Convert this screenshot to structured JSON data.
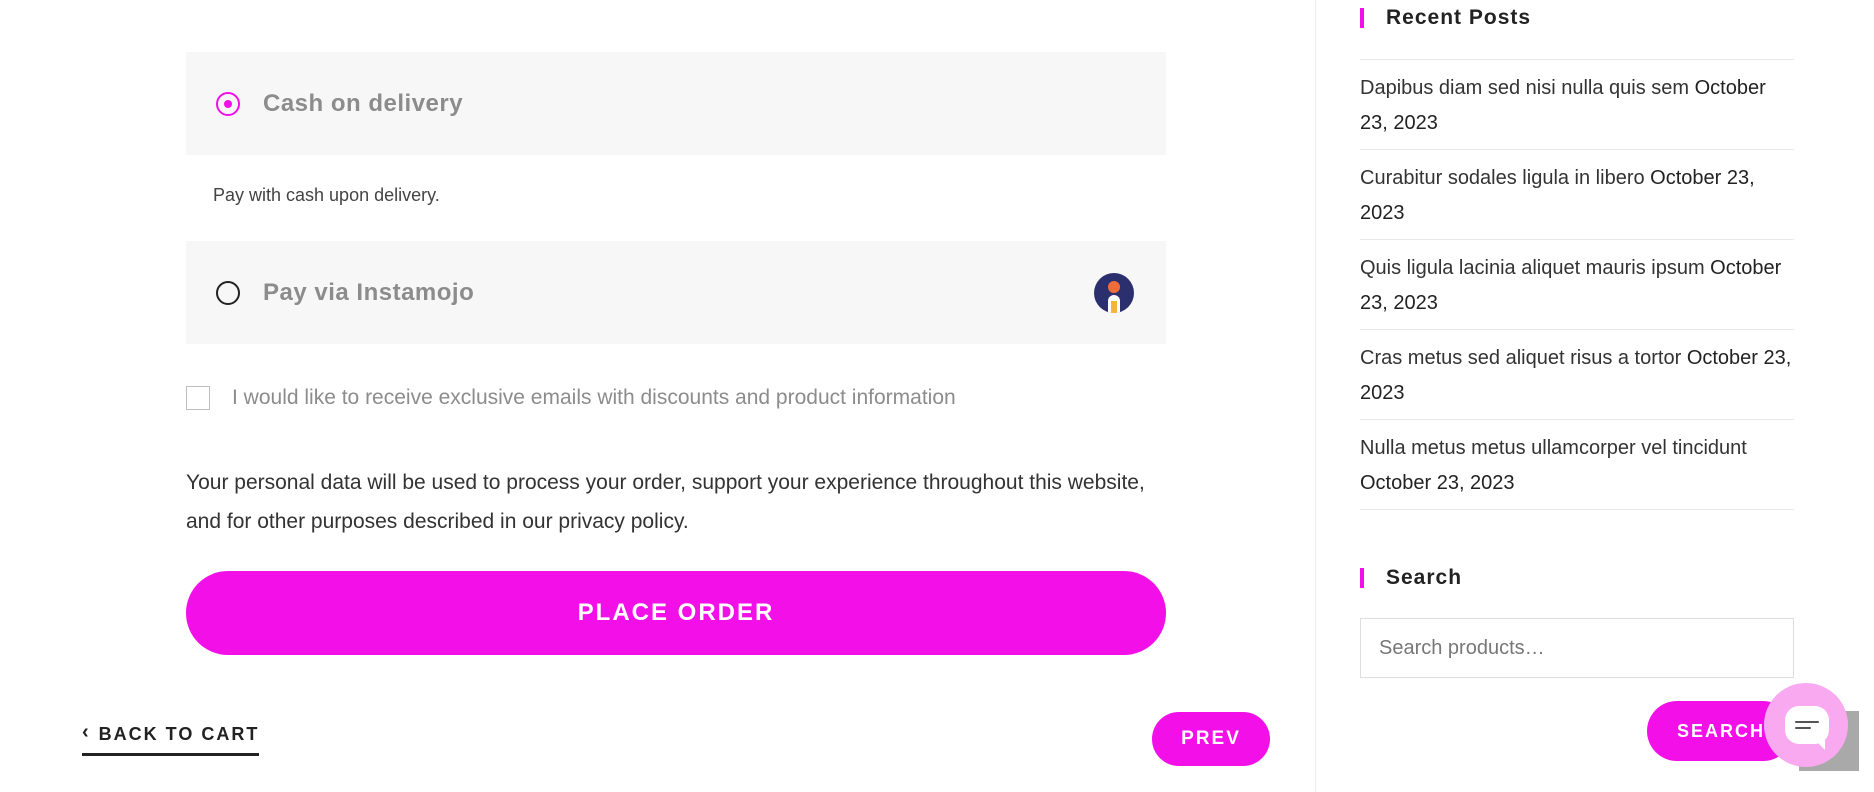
{
  "payment": {
    "cod": {
      "label": "Cash on delivery",
      "description": "Pay with cash upon delivery.",
      "selected": true
    },
    "instamojo": {
      "label": "Pay via Instamojo",
      "selected": false,
      "logo_icon": "instamojo-logo-icon"
    }
  },
  "optin": {
    "label": "I would like to receive exclusive emails with discounts and product information",
    "checked": false
  },
  "privacy": {
    "text": "Your personal data will be used to process your order, support your experience throughout this website, and for other purposes described in our",
    "link_text": "privacy policy",
    "suffix": "."
  },
  "place_order_label": "PLACE ORDER",
  "navigation": {
    "back_label": "BACK TO CART",
    "back_icon": "chevron-left-icon",
    "prev_label": "PREV"
  },
  "sidebar": {
    "recent_posts": {
      "title": "Recent Posts",
      "items": [
        {
          "title": "Dapibus diam sed nisi nulla quis sem",
          "date": "October 23, 2023"
        },
        {
          "title": "Curabitur sodales ligula in libero",
          "date": "October 23, 2023"
        },
        {
          "title": "Quis ligula lacinia aliquet mauris ipsum",
          "date": "October 23, 2023"
        },
        {
          "title": "Cras metus sed aliquet risus a tortor",
          "date": "October 23, 2023"
        },
        {
          "title": "Nulla metus metus ullamcorper vel tincidunt",
          "date": "October 23, 2023"
        }
      ]
    },
    "search": {
      "title": "Search",
      "placeholder": "Search products…",
      "button_label": "SEARCH"
    }
  },
  "colors": {
    "accent": "#f20fe8",
    "chat_bubble": "#f8a9ef",
    "scroll_top": "#a9a9a9"
  },
  "icons": {
    "chat": "chat-icon",
    "scroll_top": "scroll-to-top-icon"
  }
}
